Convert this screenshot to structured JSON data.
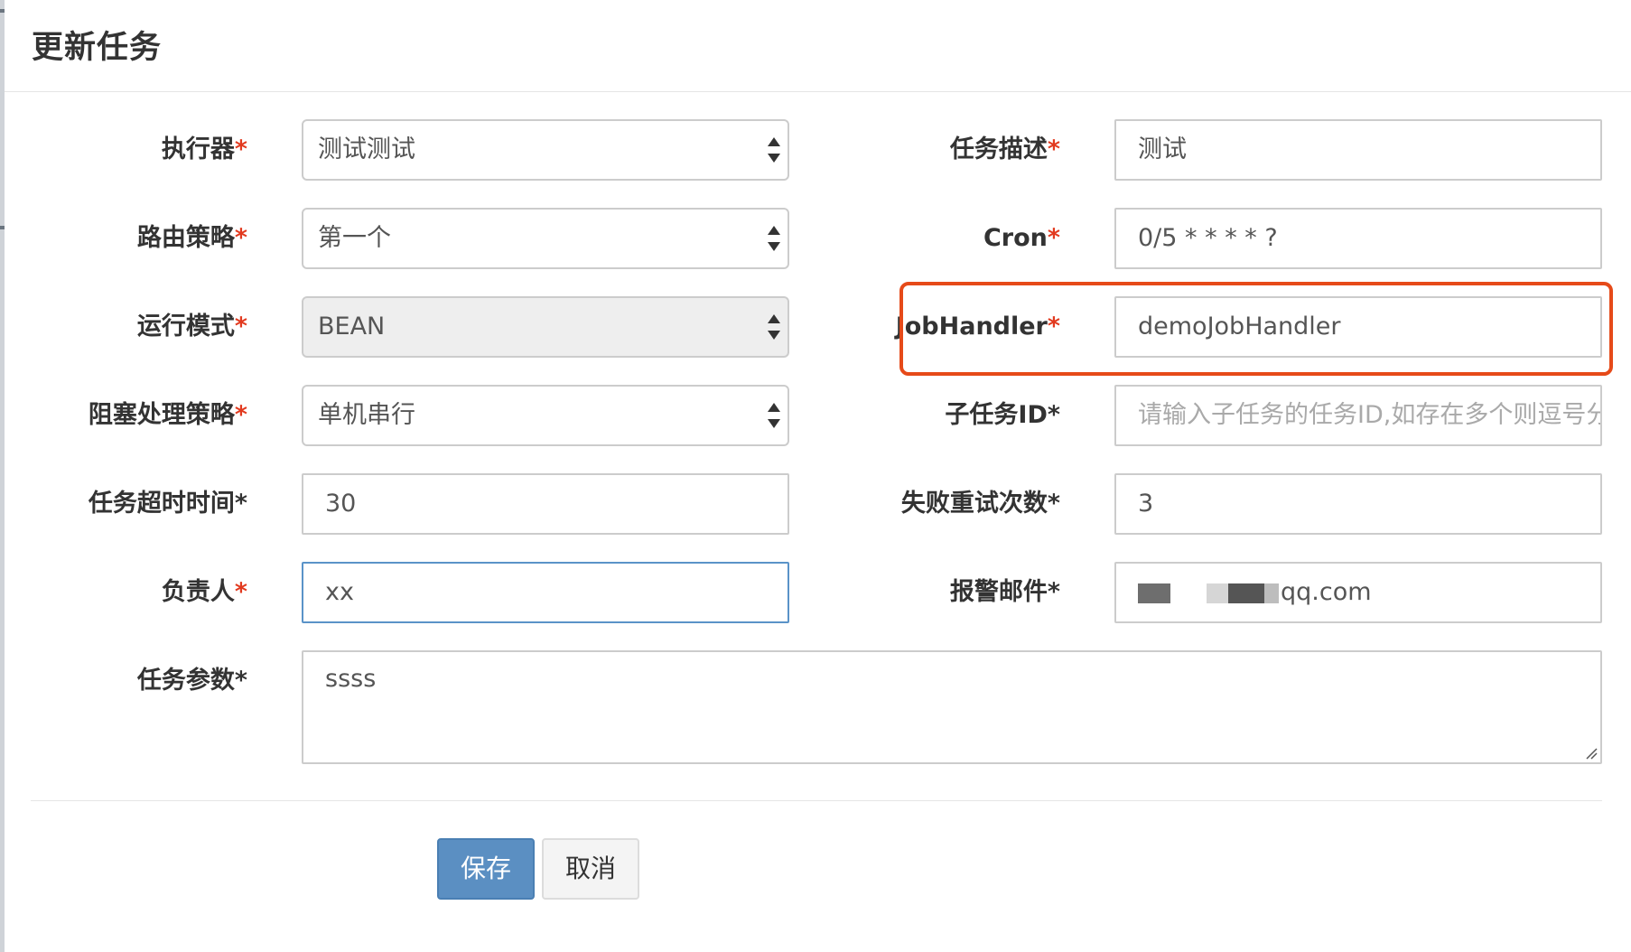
{
  "dialog": {
    "title": "更新任务",
    "highlight_color": "#e64a19"
  },
  "fields": {
    "executor": {
      "label": "执行器",
      "value": "测试测试"
    },
    "route_strategy": {
      "label": "路由策略",
      "value": "第一个"
    },
    "run_mode": {
      "label": "运行模式",
      "value": "BEAN"
    },
    "block_strategy": {
      "label": "阻塞处理策略",
      "value": "单机串行"
    },
    "timeout": {
      "label": "任务超时时间*",
      "value": "30"
    },
    "owner": {
      "label": "负责人",
      "value": "xx"
    },
    "job_params": {
      "label": "任务参数*",
      "value": "ssss"
    },
    "job_desc": {
      "label": "任务描述",
      "value": "测试"
    },
    "cron": {
      "label": "Cron",
      "value": "0/5 * * * * ?"
    },
    "job_handler": {
      "label": "JobHandler",
      "value": "demoJobHandler"
    },
    "child_job_id": {
      "label": "子任务ID*",
      "placeholder": "请输入子任务的任务ID,如存在多个则逗号分隔"
    },
    "retry_count": {
      "label": "失败重试次数*",
      "value": "3"
    },
    "alarm_email": {
      "label": "报警邮件*",
      "value_visible_suffix": "qq.com"
    },
    "required_mark": "*"
  },
  "buttons": {
    "save": "保存",
    "cancel": "取消"
  },
  "colors": {
    "primary": "#5b8fc2",
    "required": "#e23a1f",
    "focus_border": "#5a93c8"
  }
}
